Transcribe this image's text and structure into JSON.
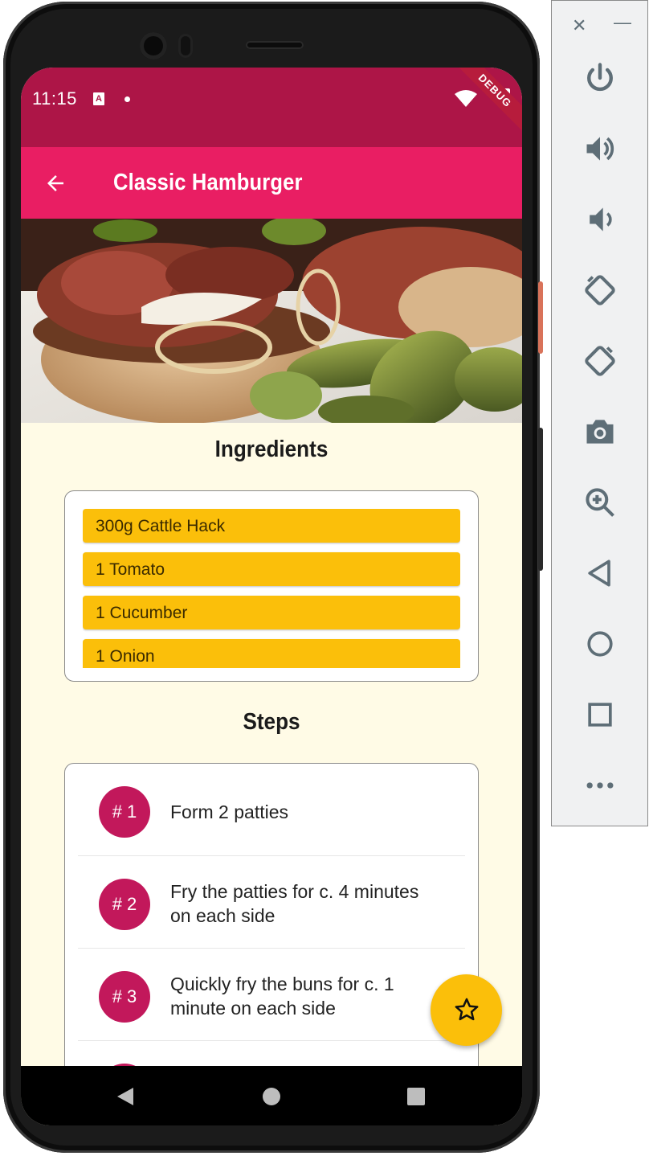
{
  "status_bar": {
    "time": "11:15",
    "debug_label": "DEBUG"
  },
  "app_bar": {
    "title": "Classic Hamburger"
  },
  "ingredients": {
    "heading": "Ingredients",
    "items": [
      "300g Cattle Hack",
      "1 Tomato",
      "1 Cucumber",
      "1 Onion"
    ]
  },
  "steps": {
    "heading": "Steps",
    "items": [
      {
        "badge": "# 1",
        "text": "Form 2 patties"
      },
      {
        "badge": "# 2",
        "text": "Fry the patties for c. 4 minutes on each side"
      },
      {
        "badge": "# 3",
        "text": "Quickly fry the buns for c. 1 minute on each side"
      }
    ]
  },
  "colors": {
    "status_bar": "#ad1547",
    "app_bar": "#e91e63",
    "accent": "#fbbf0a",
    "step_badge": "#c2185b",
    "page_background": "#fffbe6"
  },
  "icons": {
    "back": "arrow-left-icon",
    "fab": "star-outline-icon",
    "emulator": [
      "close-icon",
      "minimize-icon",
      "power-icon",
      "volume-up-icon",
      "volume-down-icon",
      "rotate-left-icon",
      "rotate-right-icon",
      "camera-icon",
      "zoom-icon",
      "back-triangle-icon",
      "home-circle-icon",
      "overview-square-icon",
      "more-icon"
    ]
  }
}
